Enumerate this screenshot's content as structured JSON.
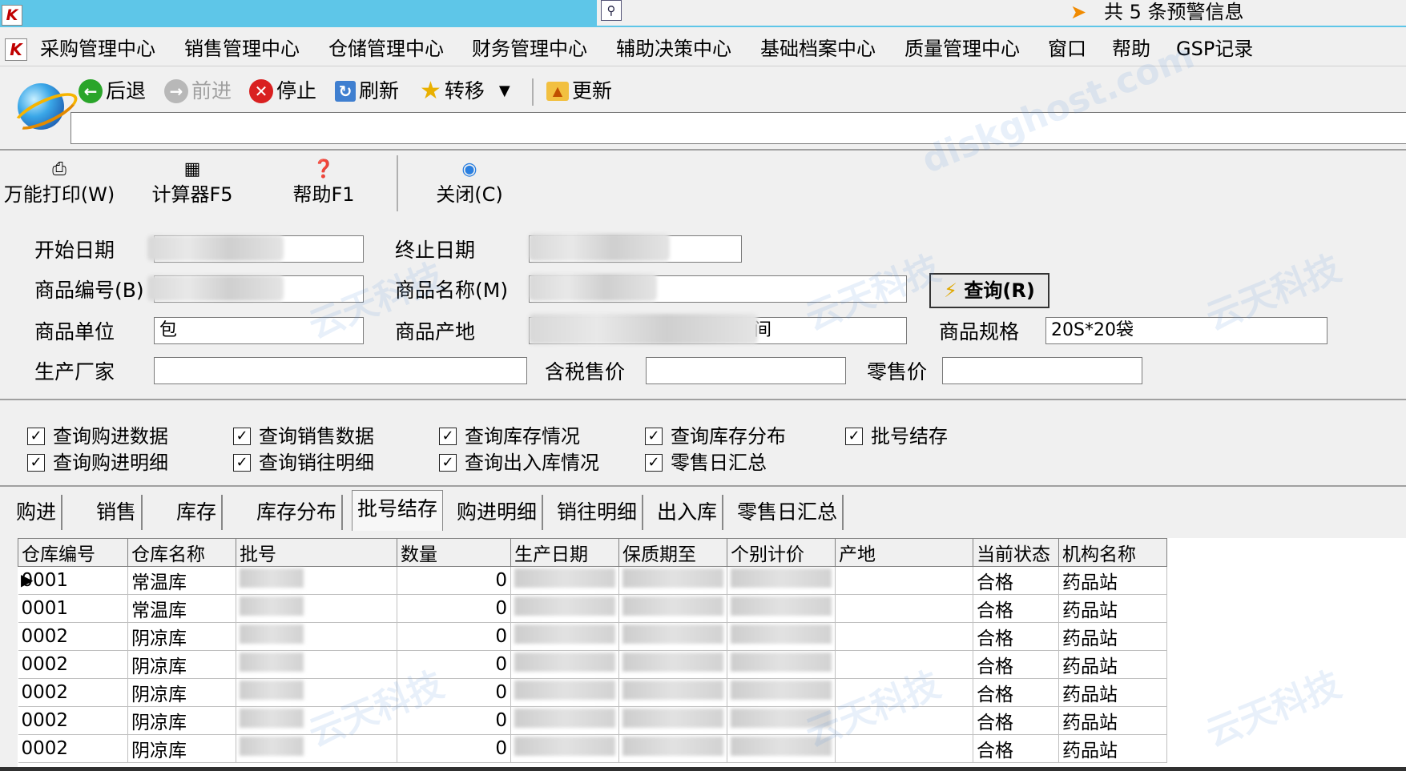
{
  "titlebar": {
    "logo": "K",
    "alert_text": "共 5 条预警信息"
  },
  "menu": {
    "logo": "K",
    "items": [
      "采购管理中心",
      "销售管理中心",
      "仓储管理中心",
      "财务管理中心",
      "辅助决策中心",
      "基础档案中心",
      "质量管理中心",
      "窗口",
      "帮助",
      "GSP记录"
    ]
  },
  "nav": {
    "back": "后退",
    "forward": "前进",
    "stop": "停止",
    "refresh": "刷新",
    "transfer": "转移",
    "update": "更新",
    "url": ""
  },
  "toolbar": {
    "print": "万能打印(W)",
    "calculator": "计算器F5",
    "help": "帮助F1",
    "close": "关闭(C)"
  },
  "form": {
    "start_date_label": "开始日期",
    "end_date_label": "终止日期",
    "product_code_label": "商品编号(B)",
    "product_name_label": "商品名称(M)",
    "query_button": "查询(R)",
    "unit_label": "商品单位",
    "unit_value": "包",
    "origin_label": "商品产地",
    "origin_suffix": "间",
    "spec_label": "商品规格",
    "spec_value": "20S*20袋",
    "manufacturer_label": "生产厂家",
    "manufacturer_value": "",
    "tax_price_label": "含税售价",
    "tax_price_value": "",
    "retail_price_label": "零售价",
    "retail_price_value": ""
  },
  "checkboxes": [
    {
      "label": "查询购进数据",
      "checked": true
    },
    {
      "label": "查询销售数据",
      "checked": true
    },
    {
      "label": "查询库存情况",
      "checked": true
    },
    {
      "label": "查询库存分布",
      "checked": true
    },
    {
      "label": "批号结存",
      "checked": true
    },
    {
      "label": "查询购进明细",
      "checked": true
    },
    {
      "label": "查询销往明细",
      "checked": true
    },
    {
      "label": "查询出入库情况",
      "checked": true
    },
    {
      "label": "零售日汇总",
      "checked": true
    }
  ],
  "tabs": [
    "购进",
    "销售",
    "库存",
    "库存分布",
    "批号结存",
    "购进明细",
    "销往明细",
    "出入库",
    "零售日汇总"
  ],
  "active_tab": "批号结存",
  "grid": {
    "columns": [
      "仓库编号",
      "仓库名称",
      "批号",
      "数量",
      "生产日期",
      "保质期至",
      "个别计价",
      "产地",
      "当前状态",
      "机构名称"
    ],
    "rows": [
      {
        "code": "0001",
        "name": "常温库",
        "qty": "0",
        "status": "合格",
        "org": "药品站"
      },
      {
        "code": "0001",
        "name": "常温库",
        "qty": "0",
        "status": "合格",
        "org": "药品站"
      },
      {
        "code": "0002",
        "name": "阴凉库",
        "qty": "0",
        "status": "合格",
        "org": "药品站"
      },
      {
        "code": "0002",
        "name": "阴凉库",
        "qty": "0",
        "status": "合格",
        "org": "药品站"
      },
      {
        "code": "0002",
        "name": "阴凉库",
        "qty": "0",
        "status": "合格",
        "org": "药品站"
      },
      {
        "code": "0002",
        "name": "阴凉库",
        "qty": "0",
        "status": "合格",
        "org": "药品站"
      },
      {
        "code": "0002",
        "name": "阴凉库",
        "qty": "0",
        "status": "合格",
        "org": "药品站"
      }
    ]
  },
  "watermarks": [
    "云天科技",
    "diskghost.com"
  ]
}
